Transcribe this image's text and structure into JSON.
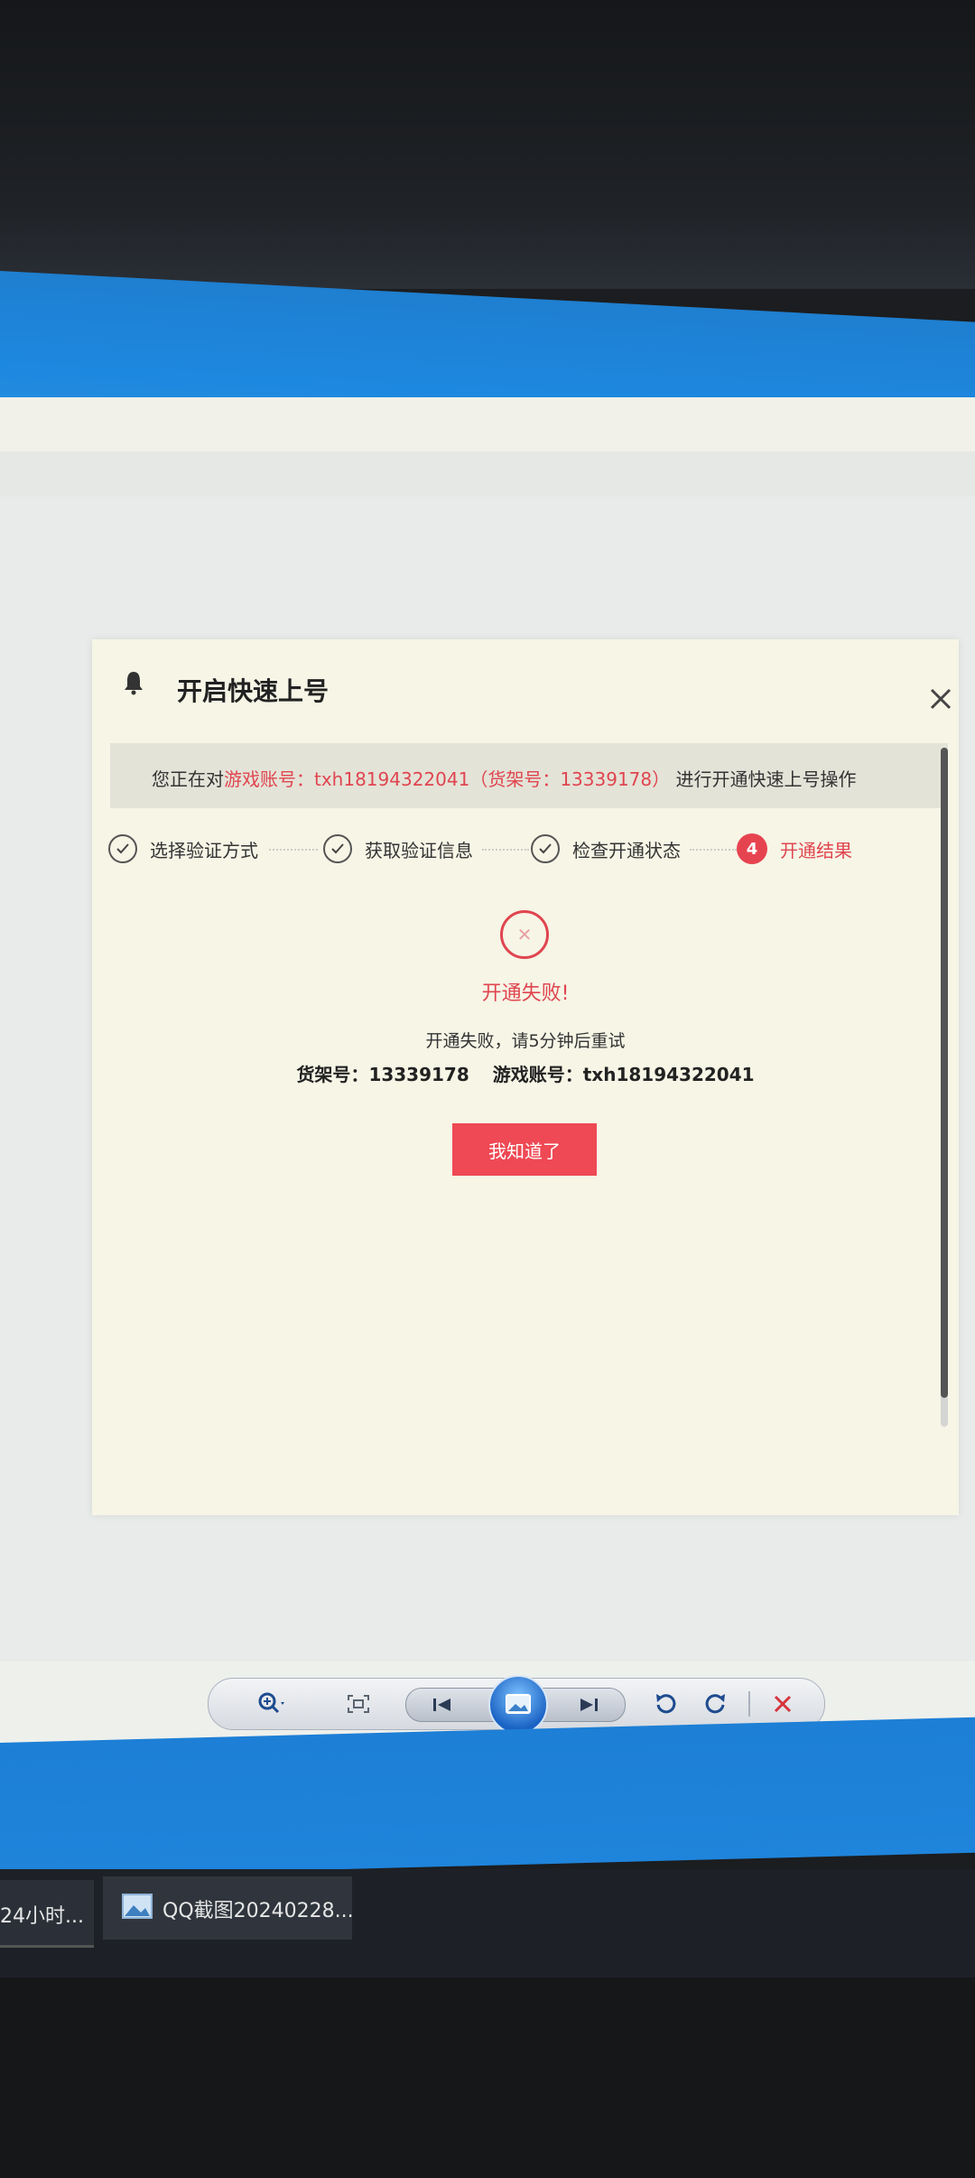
{
  "dialog": {
    "title": "开启快速上号",
    "notice": {
      "prefix": "您正在对",
      "account_part": "游戏账号：txh18194322041（货架号：13339178）",
      "suffix": "进行开通快速上号操作"
    },
    "steps": [
      {
        "label": "选择验证方式",
        "state": "done"
      },
      {
        "label": "获取验证信息",
        "state": "done"
      },
      {
        "label": "检查开通状态",
        "state": "done"
      },
      {
        "number": "4",
        "label": "开通结果",
        "state": "active"
      }
    ],
    "result": {
      "title": "开通失败!",
      "message": "开通失败，请5分钟后重试",
      "shelf_label": "货架号：",
      "shelf_value": "13339178",
      "account_label": "游戏账号：",
      "account_value": "txh18194322041"
    },
    "ok_button": "我知道了"
  },
  "viewer_toolbar": {
    "icons": [
      "zoom-icon",
      "fit-screen-icon",
      "previous-icon",
      "slideshow-icon",
      "next-icon",
      "rotate-left-icon",
      "rotate-right-icon",
      "delete-icon"
    ]
  },
  "taskbar": {
    "item1": "24小时...",
    "item2": "QQ截图20240228..."
  },
  "colors": {
    "accent_red": "#e0454f",
    "button_red": "#ee4954",
    "desktop_blue": "#1d84db"
  }
}
